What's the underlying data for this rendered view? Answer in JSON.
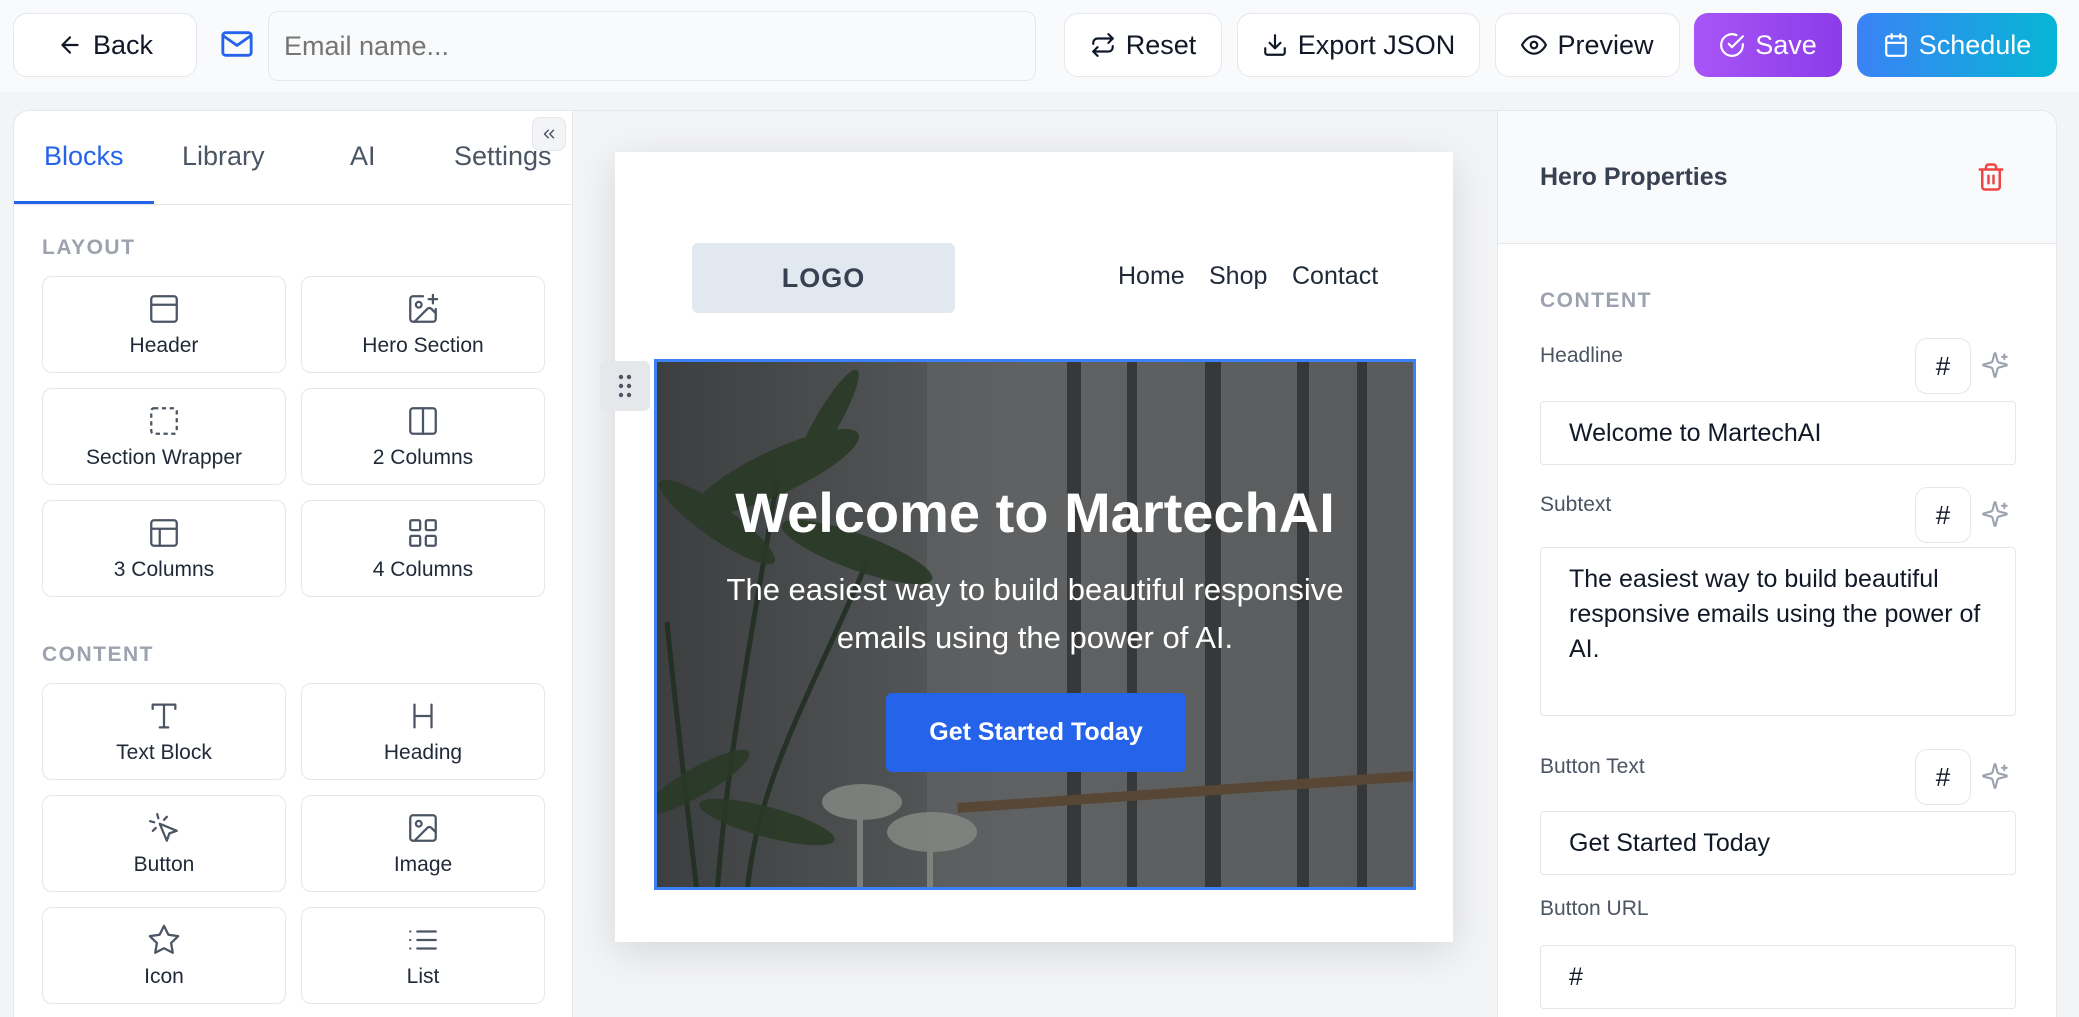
{
  "topbar": {
    "back_label": "Back",
    "email_placeholder": "Email name...",
    "reset_label": "Reset",
    "export_label": "Export JSON",
    "preview_label": "Preview",
    "save_label": "Save",
    "schedule_label": "Schedule",
    "save_gradient": [
      "#a855f7",
      "#8b3ce8"
    ],
    "schedule_gradient": [
      "#3b82f6",
      "#06b6d4"
    ]
  },
  "left_panel": {
    "tabs": [
      {
        "label": "Blocks",
        "active": true
      },
      {
        "label": "Library",
        "active": false
      },
      {
        "label": "AI",
        "active": false
      },
      {
        "label": "Settings",
        "active": false
      }
    ],
    "collapse_icon": "chevrons-left-icon",
    "layout_label": "LAYOUT",
    "layout_blocks": [
      {
        "label": "Header",
        "icon": "panel-top-icon"
      },
      {
        "label": "Hero Section",
        "icon": "image-plus-icon"
      },
      {
        "label": "Section Wrapper",
        "icon": "dashed-square-icon"
      },
      {
        "label": "2 Columns",
        "icon": "columns-2-icon"
      },
      {
        "label": "3 Columns",
        "icon": "layout-panel-icon"
      },
      {
        "label": "4 Columns",
        "icon": "grid-4-icon"
      }
    ],
    "content_label": "CONTENT",
    "content_blocks": [
      {
        "label": "Text Block",
        "icon": "type-icon"
      },
      {
        "label": "Heading",
        "icon": "heading-icon"
      },
      {
        "label": "Button",
        "icon": "pointer-click-icon"
      },
      {
        "label": "Image",
        "icon": "image-icon"
      },
      {
        "label": "Icon",
        "icon": "star-icon"
      },
      {
        "label": "List",
        "icon": "list-icon"
      }
    ]
  },
  "canvas": {
    "logo_text": "LOGO",
    "nav": [
      "Home",
      "Shop",
      "Contact"
    ],
    "hero": {
      "title": "Welcome to MartechAI",
      "subtext": "The easiest way to build beautiful responsive emails using the power of AI.",
      "button": "Get Started Today"
    },
    "accent": "#2563eb"
  },
  "properties": {
    "title": "Hero Properties",
    "section_label": "CONTENT",
    "headline_label": "Headline",
    "headline_value": "Welcome to MartechAI",
    "subtext_label": "Subtext",
    "subtext_value": "The easiest way to build beautiful responsive emails using the power of AI.",
    "button_text_label": "Button Text",
    "button_text_value": "Get Started Today",
    "button_url_label": "Button URL",
    "button_url_value": "#",
    "hash_symbol": "#"
  }
}
